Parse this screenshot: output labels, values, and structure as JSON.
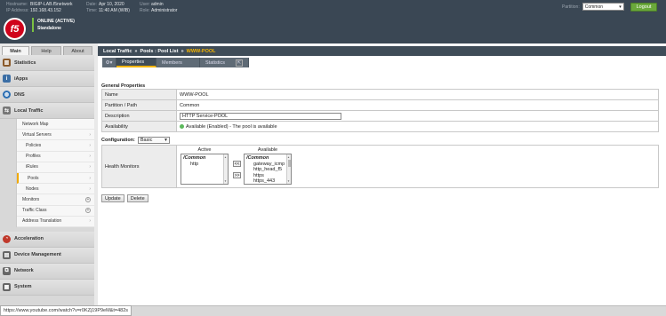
{
  "header": {
    "info": [
      {
        "key": "Hostname:",
        "value": "BIGIP-LAB.f5network"
      },
      {
        "key": "IP Address:",
        "value": "192.168.43.152"
      },
      {
        "key": "Date:",
        "value": "Apr 10, 2020"
      },
      {
        "key": "Time:",
        "value": "11:40 AM (WIB)"
      },
      {
        "key": "User:",
        "value": "admin"
      },
      {
        "key": "Role:",
        "value": "Administrator"
      }
    ],
    "status_line1": "ONLINE (ACTIVE)",
    "status_line2": "Standalone",
    "logo_text": "f5",
    "partition_label": "Partition:",
    "partition_value": "Common",
    "logout_label": "Logout"
  },
  "nav": {
    "tabs": [
      "Main",
      "Help",
      "About"
    ],
    "sections_top": [
      {
        "label": "Statistics",
        "icon": "chart-icon",
        "color": "#8a5a2b"
      },
      {
        "label": "iApps",
        "icon": "iapps-icon",
        "color": "#3b6ea5"
      },
      {
        "label": "DNS",
        "icon": "globe-icon",
        "color": "#2c6fb3"
      },
      {
        "label": "Local Traffic",
        "icon": "local-traffic-icon",
        "color": "#777"
      }
    ],
    "local_traffic_items": [
      {
        "label": "Network Map"
      },
      {
        "label": "Virtual Servers"
      },
      {
        "label": "Policies"
      },
      {
        "label": "Profiles"
      },
      {
        "label": "iRules"
      },
      {
        "label": "Pools"
      },
      {
        "label": "Nodes"
      },
      {
        "label": "Monitors"
      },
      {
        "label": "Traffic Class"
      },
      {
        "label": "Address Translation"
      }
    ],
    "sections_bottom": [
      {
        "label": "Acceleration",
        "icon": "gauge-icon",
        "color": "#c0392b"
      },
      {
        "label": "Device Management",
        "icon": "device-icon",
        "color": "#666"
      },
      {
        "label": "Network",
        "icon": "network-icon",
        "color": "#666"
      },
      {
        "label": "System",
        "icon": "system-icon",
        "color": "#666"
      }
    ]
  },
  "breadcrumb": {
    "part1": "Local Traffic",
    "sep1": "»",
    "part2": "Pools : Pool List",
    "sep2": "»",
    "current": "WWW-POOL"
  },
  "subtabs": [
    "Properties",
    "Members",
    "Statistics"
  ],
  "general": {
    "title": "General Properties",
    "rows": [
      {
        "label": "Name",
        "value": "WWW-POOL"
      },
      {
        "label": "Partition / Path",
        "value": "Common"
      },
      {
        "label": "Description",
        "value": "HTTP Service-POOL"
      },
      {
        "label": "Availability",
        "value": "Available (Enabled) - The pool is available"
      }
    ]
  },
  "configuration": {
    "label": "Configuration:",
    "value": "Basic"
  },
  "health_monitors": {
    "label": "Health Monitors",
    "active_title": "Active",
    "available_title": "Available",
    "active_group": "/Common",
    "active_items": [
      "http"
    ],
    "available_group": "/Common",
    "available_items": [
      "gateway_icmp",
      "http_head_f5",
      "https",
      "https_443"
    ],
    "move_left": "<<",
    "move_right": ">>"
  },
  "buttons": {
    "update": "Update",
    "delete": "Delete"
  },
  "status_url": "https://www.youtube.com/watch?v=r0KZj19P9eM&t=482s"
}
